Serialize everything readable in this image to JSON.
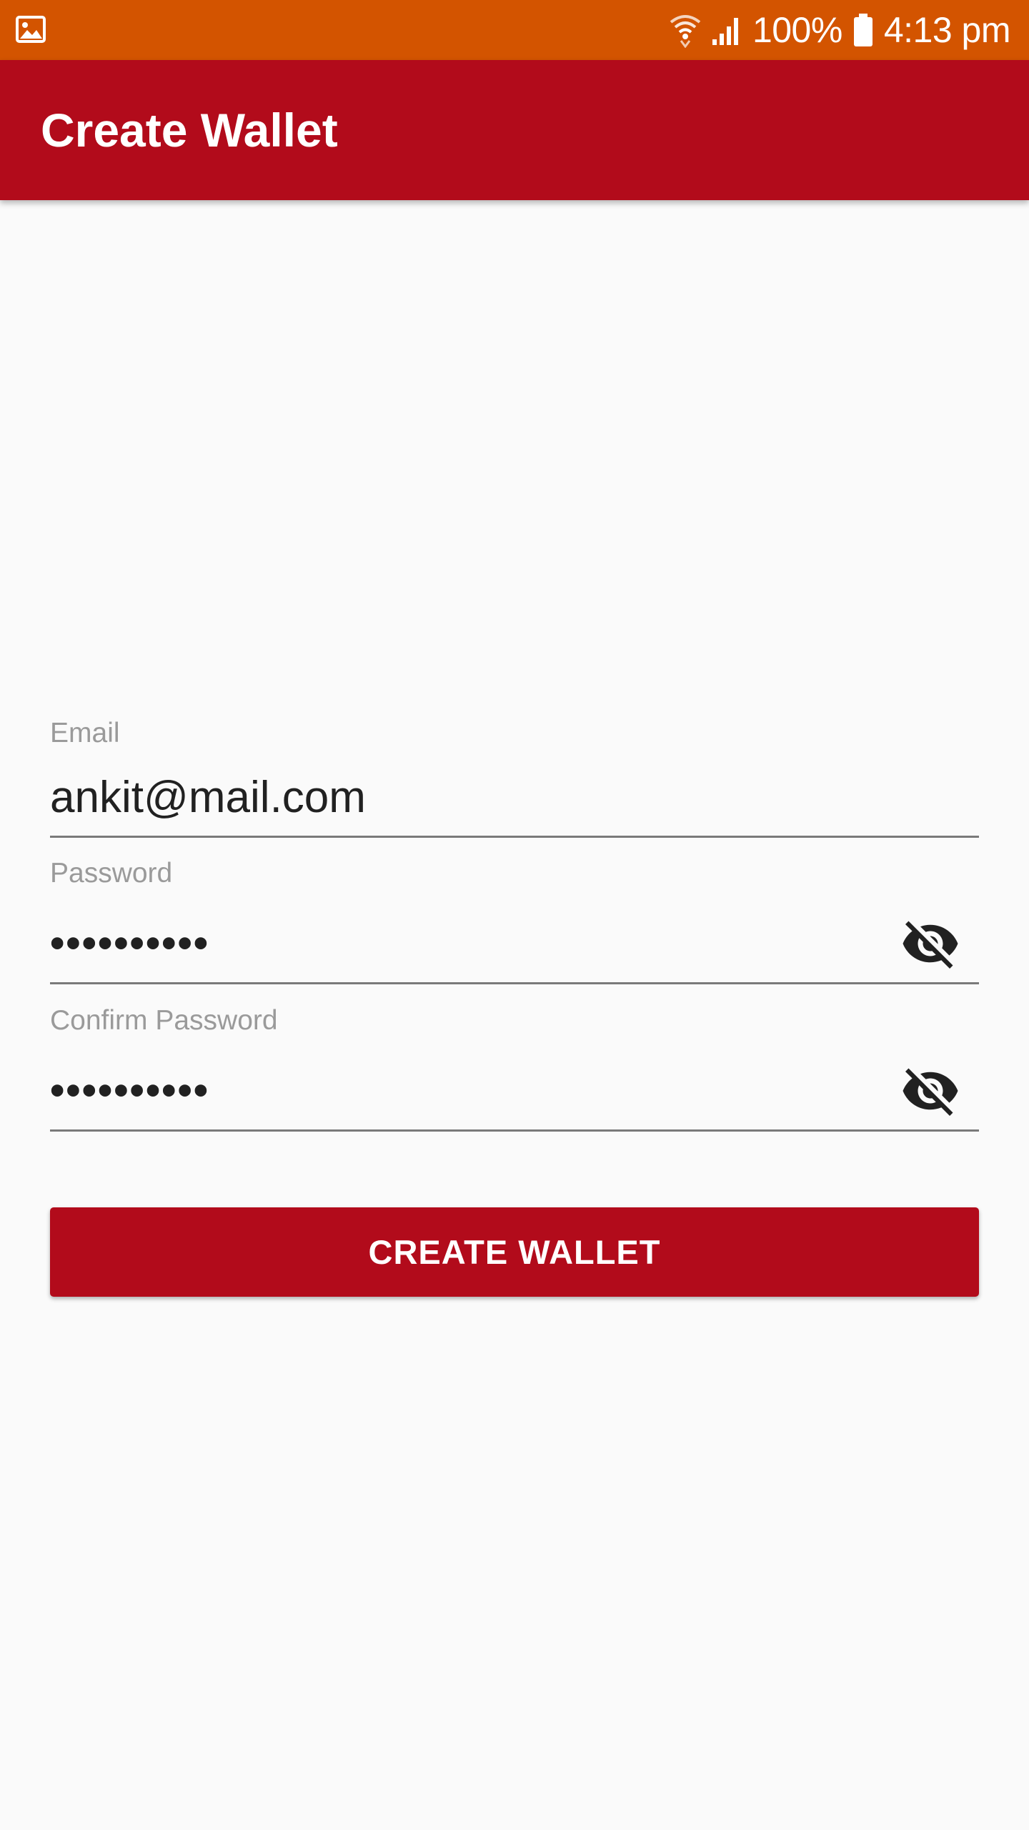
{
  "status_bar": {
    "battery": "100%",
    "time": "4:13 pm",
    "icons": [
      "gallery-icon",
      "wifi-icon",
      "signal-icon",
      "battery-icon"
    ]
  },
  "app_bar": {
    "title": "Create Wallet"
  },
  "form": {
    "email_label": "Email",
    "email_value": "ankit@mail.com",
    "password_label": "Password",
    "password_value": "••••••••••",
    "confirm_label": "Confirm Password",
    "confirm_value": "••••••••••",
    "visibility_icon": "visibility-off-icon"
  },
  "button": {
    "label": "CREATE WALLET"
  },
  "colors": {
    "status_bar": "#d35400",
    "primary": "#b20b1b",
    "background": "#fafafa"
  }
}
